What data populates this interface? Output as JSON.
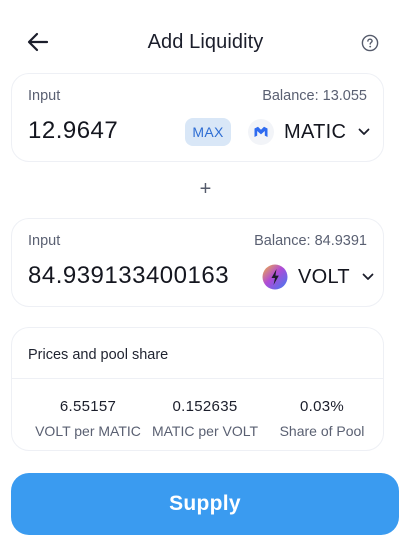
{
  "header": {
    "title": "Add Liquidity",
    "back_icon": "arrow-left-icon",
    "help_icon": "question-circle-icon"
  },
  "input_a": {
    "label": "Input",
    "balance": "Balance: 13.055",
    "amount": "12.9647",
    "max_label": "MAX",
    "token_symbol": "MATIC",
    "token_icon": "matic-logo-icon"
  },
  "plus_sign": "+",
  "input_b": {
    "label": "Input",
    "balance": "Balance: 84.9391",
    "amount": "84.939133400163",
    "token_symbol": "VOLT",
    "token_icon": "volt-logo-icon"
  },
  "prices": {
    "title": "Prices and pool share",
    "stats": [
      {
        "value": "6.55157",
        "label": "VOLT per MATIC"
      },
      {
        "value": "0.152635",
        "label": "MATIC per VOLT"
      },
      {
        "value": "0.03%",
        "label": "Share of Pool"
      }
    ]
  },
  "supply_label": "Supply",
  "colors": {
    "accent": "#3a9bf0",
    "max_bg": "#d9e7f7",
    "max_text": "#2e6dd3",
    "matic": "#2f6bf0"
  }
}
